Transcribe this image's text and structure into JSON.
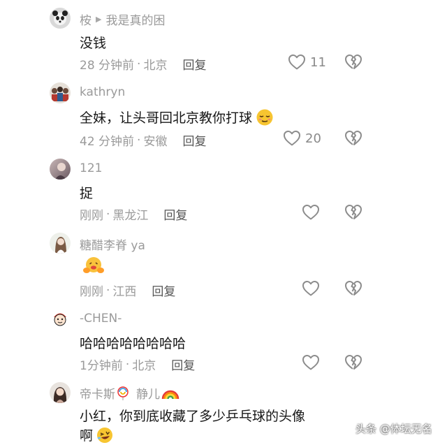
{
  "comments": [
    {
      "username": "桉",
      "reply_to": "我是真的困",
      "text": "没钱",
      "time": "28 分钟前",
      "location": "北京",
      "reply_label": "回复",
      "likes": "11"
    },
    {
      "username": "kathryn",
      "text": "全妹，让头哥回北京教你打球",
      "time": "42 分钟前",
      "location": "安徽",
      "reply_label": "回复",
      "likes": "20"
    },
    {
      "username": "121",
      "text": "捉",
      "time": "刚刚",
      "location": "黑龙江",
      "reply_label": "回复",
      "likes": ""
    },
    {
      "username": "糖醋李脊 ya",
      "text": "",
      "time": "刚刚",
      "location": "江西",
      "reply_label": "回复",
      "likes": ""
    },
    {
      "username": "-CHEN-",
      "text": "哈哈哈哈哈哈哈哈",
      "time": "1分钟前",
      "location": "北京",
      "reply_label": "回复",
      "likes": ""
    },
    {
      "username": "帝卡斯",
      "username_suffix": "静儿",
      "text": "小红，你到底收藏了多少乒乓球的头像",
      "text_line2": "啊"
    }
  ],
  "separator": "·",
  "watermark": "头条 @体坛无名",
  "icons": {
    "like": "heart-outline-icon",
    "dislike": "broken-heart-icon",
    "reply_arrow": "triangle-right-icon"
  },
  "colors": {
    "text": "#161616",
    "muted": "#9a9a9a",
    "reply": "#555555"
  }
}
